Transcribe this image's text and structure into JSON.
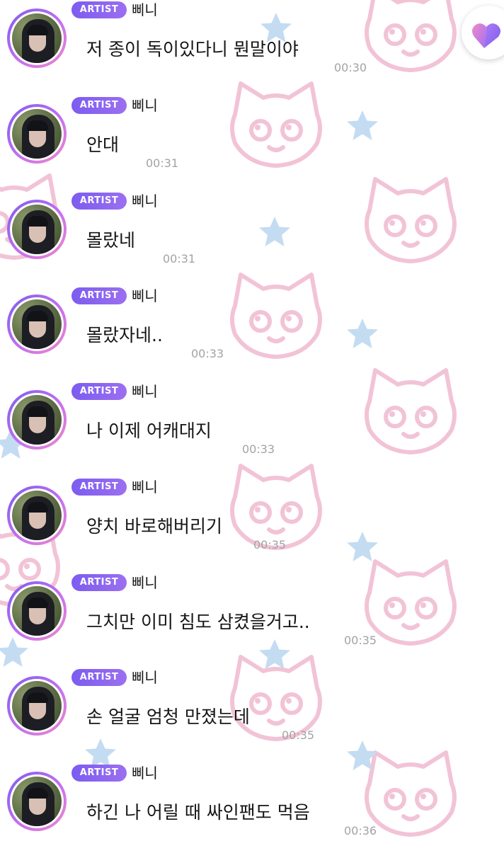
{
  "colors": {
    "badge_gradient_start": "#7c5cf0",
    "badge_gradient_end": "#9b6ff0",
    "timestamp": "#a3a3a3",
    "background_cat_outline": "#f2c3d6",
    "background_star": "#c4dcf2",
    "heart_gradient_start": "#f08ac9",
    "heart_gradient_end": "#7c5cf0"
  },
  "icons": {
    "heart_button": "heart-icon",
    "background_pattern": [
      "cat-face-icon",
      "star-icon"
    ]
  },
  "messages": [
    {
      "badge": "ARTIST",
      "name": "삐니",
      "text": "저 종이 독이있다니 뭔말이야",
      "time": "00:30"
    },
    {
      "badge": "ARTIST",
      "name": "삐니",
      "text": "안대",
      "time": "00:31"
    },
    {
      "badge": "ARTIST",
      "name": "삐니",
      "text": "몰랐네",
      "time": "00:31"
    },
    {
      "badge": "ARTIST",
      "name": "삐니",
      "text": "몰랐자네..",
      "time": "00:33"
    },
    {
      "badge": "ARTIST",
      "name": "삐니",
      "text": "나 이제 어캐대지",
      "time": "00:33"
    },
    {
      "badge": "ARTIST",
      "name": "삐니",
      "text": "양치 바로해버리기",
      "time": "00:35"
    },
    {
      "badge": "ARTIST",
      "name": "삐니",
      "text": "그치만 이미 침도 삼켰을거고..",
      "time": "00:35"
    },
    {
      "badge": "ARTIST",
      "name": "삐니",
      "text": "손 얼굴 엄청 만졌는데",
      "time": "00:35"
    },
    {
      "badge": "ARTIST",
      "name": "삐니",
      "text": "하긴 나 어릴 때 싸인팬도 먹음",
      "time": "00:36"
    }
  ]
}
